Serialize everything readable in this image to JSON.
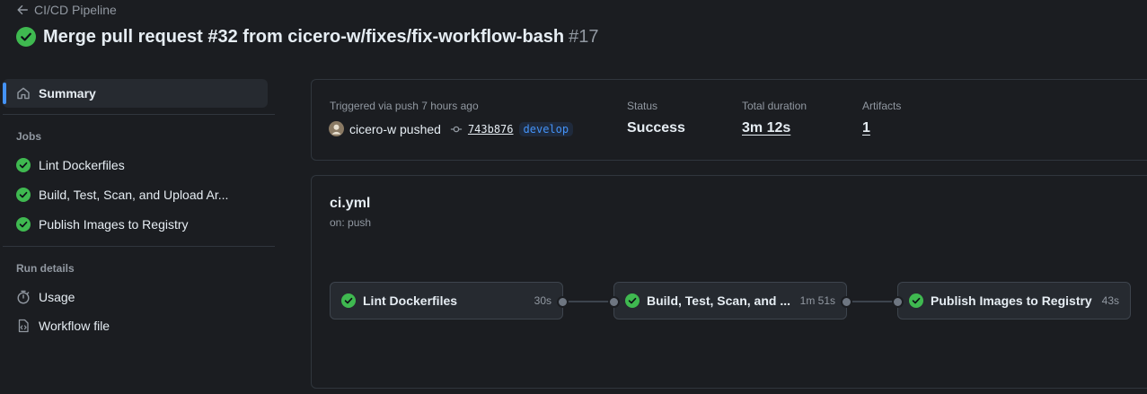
{
  "header": {
    "back_label": "CI/CD Pipeline",
    "title": "Merge pull request #32 from cicero-w/fixes/fix-workflow-bash",
    "run_number": "#17"
  },
  "sidebar": {
    "summary_label": "Summary",
    "jobs_heading": "Jobs",
    "jobs": [
      {
        "label": "Lint Dockerfiles"
      },
      {
        "label": "Build, Test, Scan, and Upload Ar..."
      },
      {
        "label": "Publish Images to Registry"
      }
    ],
    "run_details_heading": "Run details",
    "usage_label": "Usage",
    "workflow_file_label": "Workflow file"
  },
  "summary_card": {
    "trigger_label": "Triggered via push 7 hours ago",
    "actor": "cicero-w pushed",
    "commit_sha": "743b876",
    "branch": "develop",
    "status_label": "Status",
    "status_value": "Success",
    "duration_label": "Total duration",
    "duration_value": "3m 12s",
    "artifacts_label": "Artifacts",
    "artifacts_value": "1"
  },
  "workflow": {
    "file_name": "ci.yml",
    "trigger": "on: push",
    "jobs": [
      {
        "label": "Lint Dockerfiles",
        "duration": "30s"
      },
      {
        "label": "Build, Test, Scan, and ...",
        "duration": "1m 51s"
      },
      {
        "label": "Publish Images to Registry",
        "duration": "43s"
      }
    ]
  },
  "colors": {
    "success": "#3fb950",
    "accent": "#4493f8",
    "background": "#1b1d21"
  }
}
